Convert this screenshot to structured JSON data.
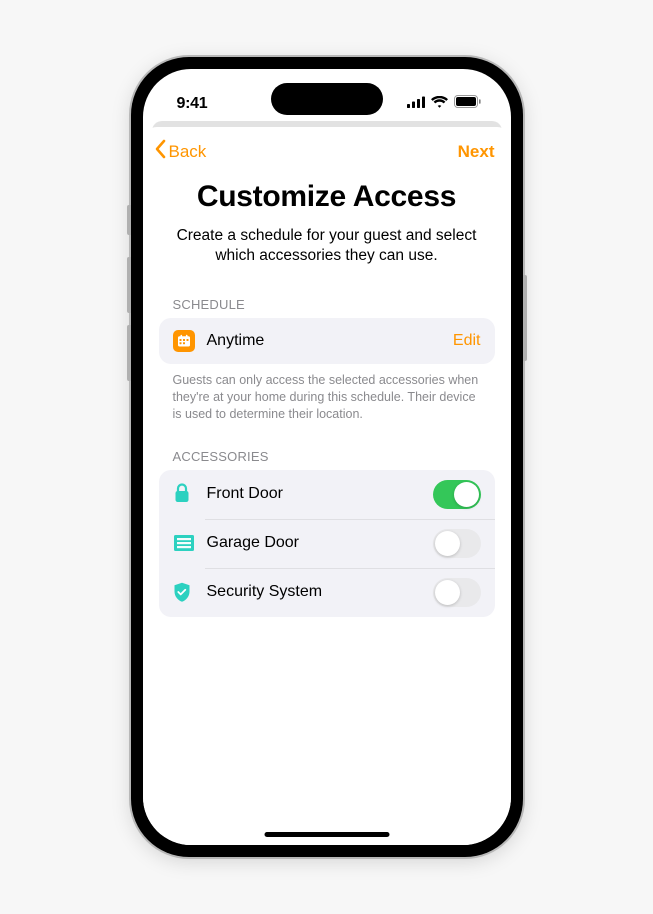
{
  "status": {
    "time": "9:41"
  },
  "nav": {
    "back": "Back",
    "next": "Next"
  },
  "page": {
    "title": "Customize Access",
    "subtitle": "Create a schedule for your guest and select which accessories they can use."
  },
  "schedule": {
    "header": "SCHEDULE",
    "value": "Anytime",
    "edit_label": "Edit",
    "footer": "Guests can only access the selected accessories when they're at your home during this schedule. Their device is used to determine their location."
  },
  "accessories": {
    "header": "ACCESSORIES",
    "items": [
      {
        "name": "Front Door",
        "icon": "lock",
        "enabled": true
      },
      {
        "name": "Garage Door",
        "icon": "garage",
        "enabled": false
      },
      {
        "name": "Security System",
        "icon": "shield",
        "enabled": false
      }
    ]
  },
  "colors": {
    "accent": "#ff9500",
    "toggle_on": "#34c759",
    "accessory_icon": "#2cd1c0"
  }
}
